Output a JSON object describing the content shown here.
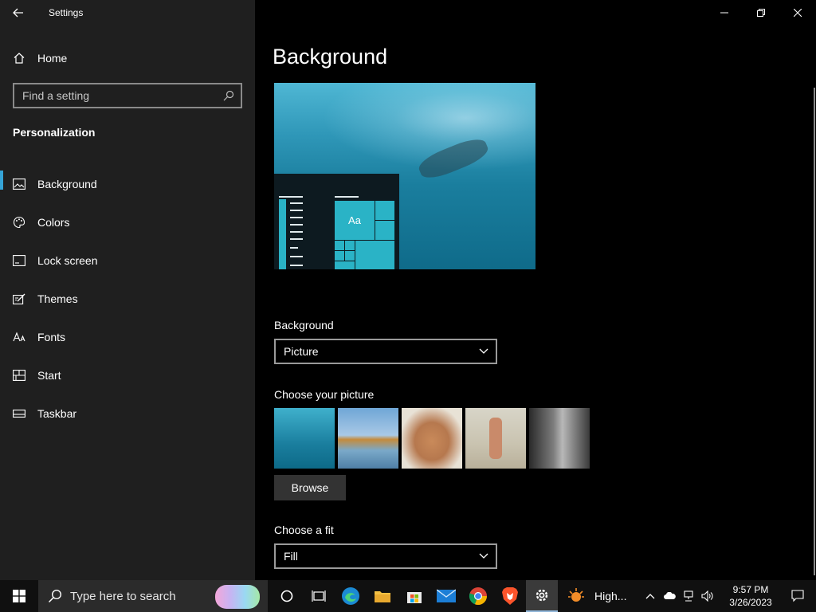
{
  "window": {
    "title": "Settings"
  },
  "sidebar": {
    "home_label": "Home",
    "search_placeholder": "Find a setting",
    "section_title": "Personalization",
    "items": [
      {
        "label": "Background",
        "icon": "picture-icon",
        "active": true
      },
      {
        "label": "Colors",
        "icon": "palette-icon"
      },
      {
        "label": "Lock screen",
        "icon": "lock-screen-icon"
      },
      {
        "label": "Themes",
        "icon": "themes-icon"
      },
      {
        "label": "Fonts",
        "icon": "fonts-icon"
      },
      {
        "label": "Start",
        "icon": "start-icon"
      },
      {
        "label": "Taskbar",
        "icon": "taskbar-icon"
      }
    ]
  },
  "main": {
    "title": "Background",
    "preview": {
      "tile_label": "Aa"
    },
    "background_label": "Background",
    "background_value": "Picture",
    "choose_picture_label": "Choose your picture",
    "browse_label": "Browse",
    "fit_label": "Choose a fit",
    "fit_value": "Fill"
  },
  "taskbar": {
    "search_placeholder": "Type here to search",
    "weather_text": "High...",
    "time": "9:57 PM",
    "date": "3/26/2023",
    "apps": [
      "cortana-icon",
      "task-view-icon",
      "edge-icon",
      "file-explorer-icon",
      "store-icon",
      "mail-icon",
      "chrome-icon",
      "brave-icon",
      "settings-icon"
    ]
  },
  "colors": {
    "accent": "#35a3d6",
    "sidebar_bg": "#1f1f1f",
    "main_bg": "#000000",
    "taskbar_bg": "#101010"
  }
}
